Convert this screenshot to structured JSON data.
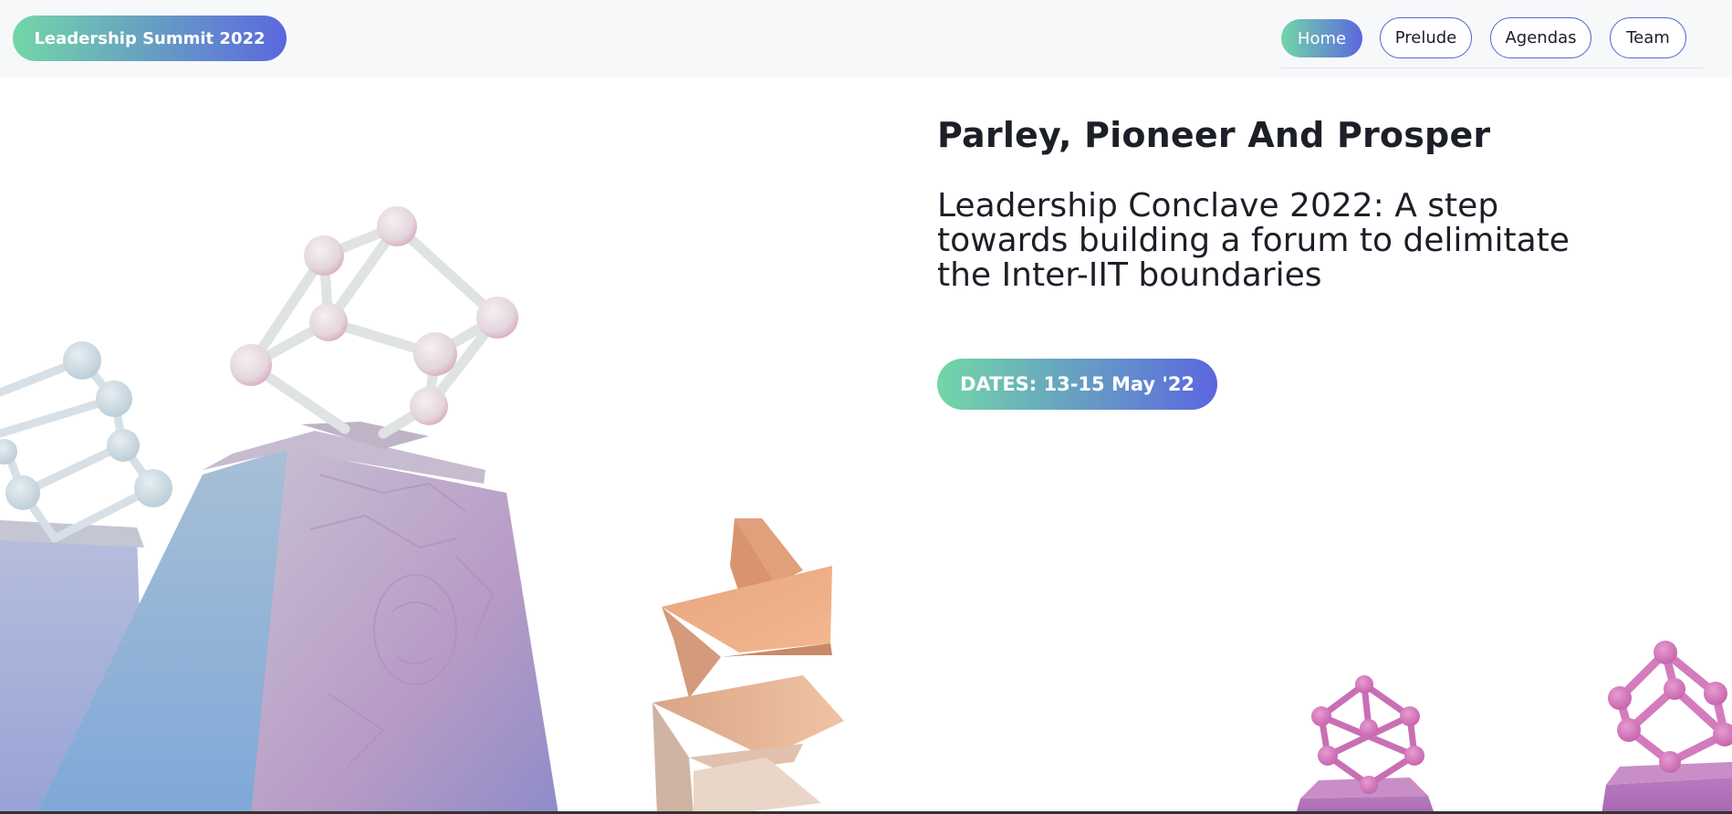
{
  "brand": {
    "label": "Leadership Summit 2022"
  },
  "nav": {
    "items": [
      {
        "label": "Home",
        "active": true
      },
      {
        "label": "Prelude",
        "active": false
      },
      {
        "label": "Agendas",
        "active": false
      },
      {
        "label": "Team",
        "active": false
      }
    ]
  },
  "hero": {
    "headline": "Parley, Pioneer And Prosper",
    "subheadline": "Leadership Conclave 2022: A step towards building a forum to delimitate the Inter-IIT boundaries",
    "dates_button": "DATES: 13-15 May '22"
  },
  "colors": {
    "accent_gradient_start": "#72d7a7",
    "accent_gradient_end": "#5b67df",
    "nav_border": "#5b67c9",
    "text": "#1d1f28"
  }
}
